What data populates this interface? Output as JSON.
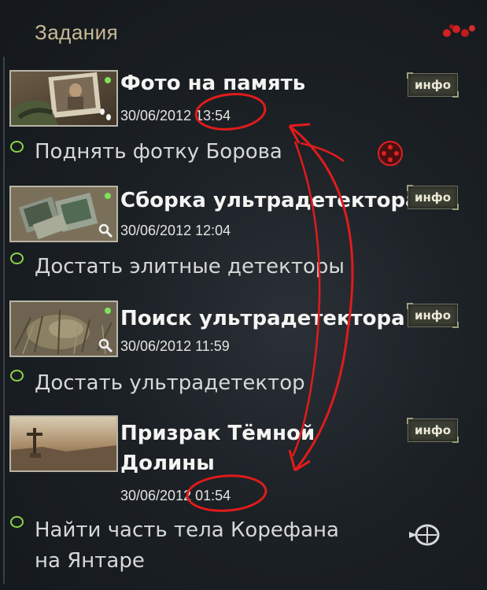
{
  "header": {
    "title": "Задания"
  },
  "info_label": "инфо",
  "tasks": [
    {
      "title": "Фото на память",
      "timestamp": "30/06/2012 13:54",
      "thumbnail": "photo-memory-thumbnail",
      "corner_icon": "footsteps-icon",
      "subtask": "Поднять фотку Борова",
      "subtask_icon": "red-target-icon"
    },
    {
      "title": "Сборка ультрадетектора",
      "timestamp": "30/06/2012 12:04",
      "thumbnail": "detectors-thumbnail",
      "corner_icon": "magnifier-icon",
      "subtask": "Достать элитные детекторы",
      "subtask_icon": ""
    },
    {
      "title": "Поиск ультрадетектора",
      "timestamp": "30/06/2012 11:59",
      "thumbnail": "grass-thumbnail",
      "corner_icon": "magnifier-icon",
      "subtask": "Достать ультрадетектор",
      "subtask_icon": ""
    },
    {
      "title_line1": "Призрак Тёмной",
      "title_line2": "Долины",
      "timestamp": "30/06/2012 01:54",
      "thumbnail": "dark-valley-thumbnail",
      "subtask_line1": "Найти часть тела Корефана",
      "subtask_line2": "на Янтаре",
      "subtask_icon": "location-marker-icon"
    }
  ],
  "colors": {
    "accent_green": "#8bd34a",
    "header_gold": "#c9b994",
    "annotation_red": "#e01b1b"
  }
}
